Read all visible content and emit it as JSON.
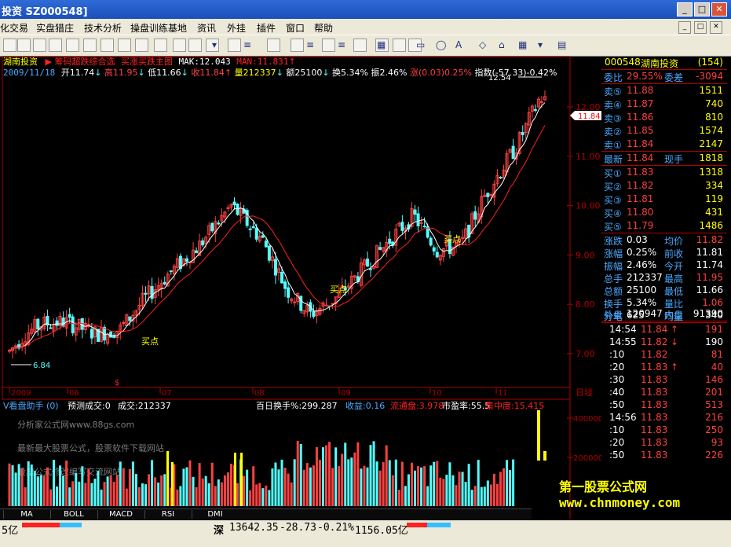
{
  "window": {
    "title": "投资  SZ000548]"
  },
  "menu": [
    {
      "label": "化交易",
      "x": 0
    },
    {
      "label": "实盘猎庄",
      "x": 46
    },
    {
      "label": "技术分析",
      "x": 107
    },
    {
      "label": "操盘训练基地",
      "x": 166
    },
    {
      "label": "资讯",
      "x": 251
    },
    {
      "label": "外挂",
      "x": 289
    },
    {
      "label": "插件",
      "x": 327
    },
    {
      "label": "窗口",
      "x": 364
    },
    {
      "label": "帮助",
      "x": 400
    }
  ],
  "chart_header": {
    "stock": "湖南投资",
    "indicator": "筹码超跌综合选",
    "indicator2": "买涨买跌主图",
    "mak": "MAK:12.043",
    "man": "MAN:11.831",
    "date": "2009/11/18",
    "open": "开11.74",
    "high": "高11.95",
    "low": "低11.66",
    "close": "收11.84",
    "vol": "量212337",
    "amt": "额25100",
    "turn": "换5.34%",
    "amp": "振2.46%",
    "chg": "涨(0.03)0.25%",
    "idx": "指数(-57.33)-0.42%"
  },
  "price_labels": {
    "hi": "12.54",
    "lo": "6.84",
    "cur": "11.84",
    "buy": "买点"
  },
  "y_ticks": [
    "12.00",
    "11.00",
    "10.00",
    "9.00",
    "8.00",
    "7.00"
  ],
  "x_ticks": [
    "2009",
    "06",
    "07",
    "08",
    "09",
    "10",
    "11"
  ],
  "x_unit": "日线",
  "sub_header": {
    "name": "V看盘助手 (0)",
    "pred": "预测成交:0",
    "vol": "成交:212337",
    "hundred": "百日换手%:299.287",
    "profit": "收益:0.16",
    "float": "流通盘:3.978",
    "pe": "市盈率:55.5",
    "conc": "集中度:15.415"
  },
  "sub_ticks": [
    "400000",
    "200000"
  ],
  "watermarks": [
    "分析家公式网www.88gs.com",
    "最新最大股票公式，股票软件下载网站",
    "股票公式修改编写交流网站"
  ],
  "tabs": [
    "MA",
    "BOLL",
    "MACD",
    "RSI",
    "DMI"
  ],
  "quote": {
    "code": "000548",
    "name": "湖南投资",
    "num": "(154)",
    "wb": "委比",
    "wb_v": "29.55%",
    "wc": "委差",
    "wc_v": "-3094",
    "asks": [
      {
        "l": "卖⑤",
        "p": "11.88",
        "q": "1511"
      },
      {
        "l": "卖④",
        "p": "11.87",
        "q": "740"
      },
      {
        "l": "卖③",
        "p": "11.86",
        "q": "810"
      },
      {
        "l": "卖②",
        "p": "11.85",
        "q": "1574"
      },
      {
        "l": "卖①",
        "p": "11.84",
        "q": "2147"
      }
    ],
    "last": "最新",
    "last_v": "11.84",
    "hand": "现手",
    "hand_v": "1818",
    "bids": [
      {
        "l": "买①",
        "p": "11.83",
        "q": "1318"
      },
      {
        "l": "买②",
        "p": "11.82",
        "q": "334"
      },
      {
        "l": "买③",
        "p": "11.81",
        "q": "119"
      },
      {
        "l": "买④",
        "p": "11.80",
        "q": "431"
      },
      {
        "l": "买⑤",
        "p": "11.79",
        "q": "1486"
      }
    ],
    "stats": [
      {
        "a": "涨跌",
        "av": "0.03",
        "b": "均价",
        "bv": "11.82"
      },
      {
        "a": "涨幅",
        "av": "0.25%",
        "b": "前收",
        "bv": "11.81"
      },
      {
        "a": "振幅",
        "av": "2.46%",
        "b": "今开",
        "bv": "11.74"
      },
      {
        "a": "总手",
        "av": "212337",
        "b": "最高",
        "bv": "11.95"
      },
      {
        "a": "总额",
        "av": "25100",
        "b": "最低",
        "bv": "11.66"
      },
      {
        "a": "换手",
        "av": "5.34%",
        "b": "量比",
        "bv": "1.06"
      },
      {
        "a": "分笔",
        "av": "625",
        "b": "均量",
        "bv": "340"
      }
    ],
    "outer": "外盘",
    "outer_v": "120947",
    "inner": "内盘",
    "inner_v": "91390",
    "ticks": [
      {
        "t": "14:54",
        "p": "11.84",
        "a": "↑",
        "q": "191",
        "c": "r"
      },
      {
        "t": "14:55",
        "p": "11.82",
        "a": "↓",
        "q": "190",
        "c": "c"
      },
      {
        "t": ":10",
        "p": "11.82",
        "a": "",
        "q": "81",
        "c": "r"
      },
      {
        "t": ":20",
        "p": "11.83",
        "a": "↑",
        "q": "40",
        "c": "r"
      },
      {
        "t": ":30",
        "p": "11.83",
        "a": "",
        "q": "146",
        "c": "r"
      },
      {
        "t": ":40",
        "p": "11.83",
        "a": "",
        "q": "201",
        "c": "r"
      },
      {
        "t": ":50",
        "p": "11.83",
        "a": "",
        "q": "513",
        "c": "r"
      },
      {
        "t": "14:56",
        "p": "11.83",
        "a": "",
        "q": "216",
        "c": "r"
      },
      {
        "t": ":10",
        "p": "11.83",
        "a": "",
        "q": "250",
        "c": "r"
      },
      {
        "t": ":20",
        "p": "11.83",
        "a": "",
        "q": "93",
        "c": "r"
      },
      {
        "t": ":50",
        "p": "11.83",
        "a": "",
        "q": "226",
        "c": "r"
      }
    ]
  },
  "brand": {
    "name": "第一股票公式网",
    "url": "www.chnmoney.com"
  },
  "status": {
    "left": "5亿",
    "market": "深",
    "index": "13642.35",
    "chg": "-28.73",
    "pct": "-0.21%",
    "amt": "1156.05亿"
  },
  "colors": {
    "up": "#ff4040",
    "down": "#54ffff",
    "ma1": "#ffffff",
    "ma2": "#ff2020",
    "axis": "#b00000",
    "label": "#4aa8ff",
    "yellow": "#ffff00"
  }
}
